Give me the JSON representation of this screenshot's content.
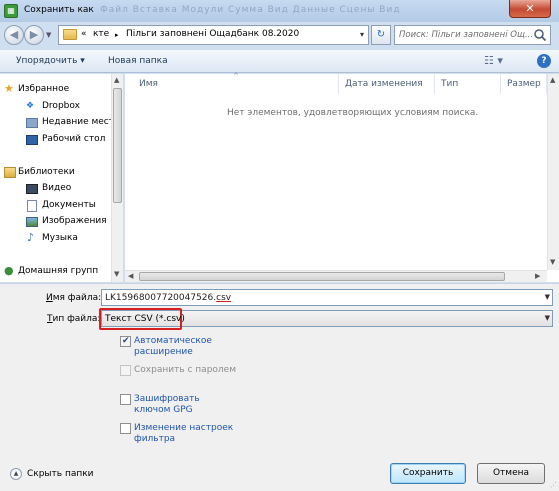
{
  "window": {
    "title": "Сохранить как",
    "ghost_menu": "Файл   Вставка   Модули   Сумма   Вид   Данные   Сцены   Вид",
    "close_glyph": "✕"
  },
  "address": {
    "crumb_prefix": "«",
    "crumb_parent": "ктe",
    "separator": "▸",
    "crumb_current": "Пільги заповнені Ощадбанк 08.2020",
    "search_placeholder": "Поиск: Пільги заповнені Ощ..."
  },
  "toolbar": {
    "organize": "Упорядочить ▾",
    "new_folder": "Новая папка",
    "view_glyph": "☷ ▾",
    "help_glyph": "?"
  },
  "nav": {
    "favorites": "Избранное",
    "dropbox": "Dropbox",
    "recent": "Недавние места",
    "desktop": "Рабочий стол",
    "libraries": "Библиотеки",
    "video": "Видео",
    "documents": "Документы",
    "images": "Изображения",
    "music": "Музыка",
    "homegroup": "Домашняя групп"
  },
  "columns": {
    "name": "Имя",
    "date": "Дата изменения",
    "type": "Тип",
    "size": "Размер"
  },
  "empty_message": "Нет элементов, удовлетворяющих условиям поиска.",
  "form": {
    "filename_label_u": "И",
    "filename_label_rest": "мя файла:",
    "filename_base": "LK15968007720047526.",
    "filename_ext": "csv",
    "filetype_label_u": "Т",
    "filetype_label_rest": "ип файла:",
    "filetype_value": "Текст CSV (*.csv)"
  },
  "options": {
    "auto_ext": "Автоматическое расширение",
    "auto_ext_checked": true,
    "password": "Сохранить с паролем",
    "password_checked": false,
    "gpg": "Зашифровать ключом GPG",
    "gpg_checked": false,
    "filter": "Изменение настроек фильтра",
    "filter_checked": false
  },
  "footer": {
    "hide_folders": "Скрыть папки",
    "save": "Сохранить",
    "cancel": "Отмена"
  },
  "colors": {
    "highlight_red": "#d81f1f",
    "link_blue": "#1f55ad",
    "title_bar": "#c6daf0"
  }
}
